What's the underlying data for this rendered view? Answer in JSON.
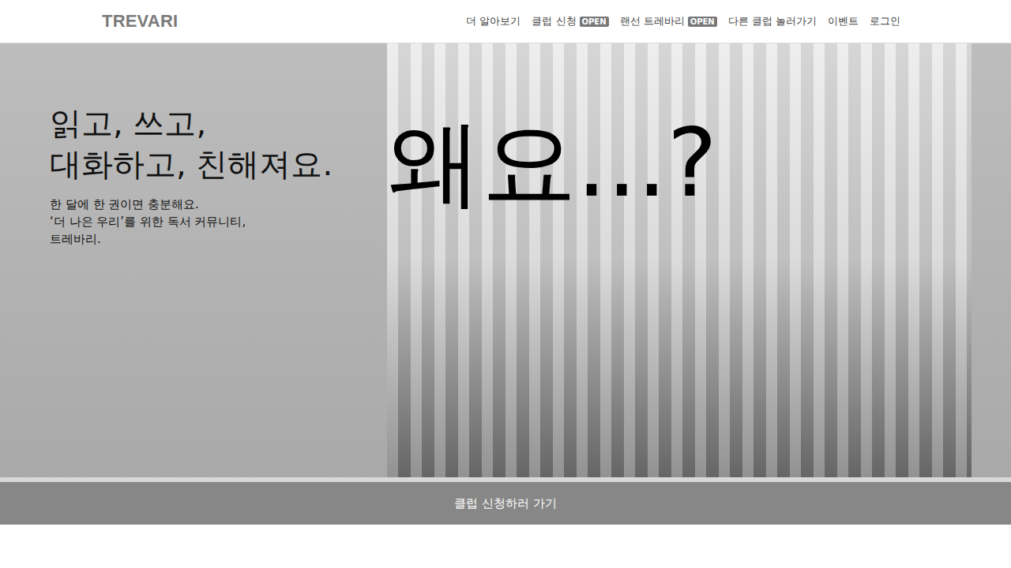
{
  "header": {
    "logo": "TREVARI",
    "nav": [
      {
        "label": "더 알아보기"
      },
      {
        "label": "클럽 신청",
        "badge": "OPEN"
      },
      {
        "label": "랜선 트레바리",
        "badge": "OPEN"
      },
      {
        "label": "다른 클럽 놀러가기"
      },
      {
        "label": "이벤트"
      },
      {
        "label": "로그인"
      }
    ]
  },
  "hero": {
    "headline": [
      "읽고, 쓰고,",
      "대화하고, 친해져요."
    ],
    "subtext": [
      "한 달에 한 권이면 충분해요.",
      "‘더 나은 우리’를 위한 독서 커뮤니티,",
      "트레바리."
    ],
    "overlay": "왜요...?"
  },
  "cta": {
    "label": "클럽 신청하러 가기"
  }
}
